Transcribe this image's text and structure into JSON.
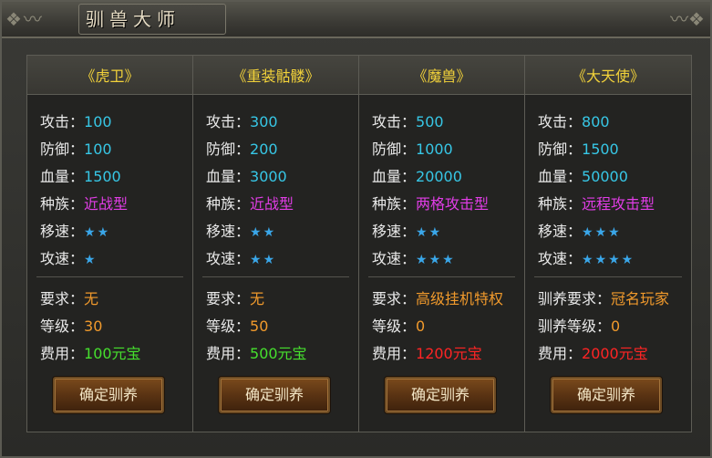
{
  "window": {
    "title": "驯兽大师"
  },
  "cards": [
    {
      "name": "《虎卫》",
      "attack_label": "攻击：",
      "attack": "100",
      "defense_label": "防御：",
      "defense": "100",
      "hp_label": "血量：",
      "hp": "1500",
      "race_label": "种族：",
      "race": "近战型",
      "move_label": "移速：",
      "move_stars": "★★",
      "atkspeed_label": "攻速：",
      "atkspeed_stars": "★",
      "req_label": "要求：",
      "req": "无",
      "level_label": "等级：",
      "level": "30",
      "cost_label": "费用：",
      "cost": "100元宝",
      "button": "确定驯养"
    },
    {
      "name": "《重装骷髅》",
      "attack_label": "攻击：",
      "attack": "300",
      "defense_label": "防御：",
      "defense": "200",
      "hp_label": "血量：",
      "hp": "3000",
      "race_label": "种族：",
      "race": "近战型",
      "move_label": "移速：",
      "move_stars": "★★",
      "atkspeed_label": "攻速：",
      "atkspeed_stars": "★★",
      "req_label": "要求：",
      "req": "无",
      "level_label": "等级：",
      "level": "50",
      "cost_label": "费用：",
      "cost": "500元宝",
      "button": "确定驯养"
    },
    {
      "name": "《魔兽》",
      "attack_label": "攻击：",
      "attack": "500",
      "defense_label": "防御：",
      "defense": "1000",
      "hp_label": "血量：",
      "hp": "20000",
      "race_label": "种族：",
      "race": "两格攻击型",
      "move_label": "移速：",
      "move_stars": "★★",
      "atkspeed_label": "攻速：",
      "atkspeed_stars": "★★★",
      "req_label": "要求：",
      "req": "高级挂机特权",
      "level_label": "等级：",
      "level": "0",
      "cost_label": "费用：",
      "cost": "1200元宝",
      "button": "确定驯养"
    },
    {
      "name": "《大天使》",
      "attack_label": "攻击：",
      "attack": "800",
      "defense_label": "防御：",
      "defense": "1500",
      "hp_label": "血量：",
      "hp": "50000",
      "race_label": "种族：",
      "race": "远程攻击型",
      "move_label": "移速：",
      "move_stars": "★★★",
      "atkspeed_label": "攻速：",
      "atkspeed_stars": "★★★★",
      "req_label": "驯养要求：",
      "req": "冠名玩家",
      "level_label": "驯养等级：",
      "level": "0",
      "cost_label": "费用：",
      "cost": "2000元宝",
      "button": "确定驯养"
    }
  ],
  "colors": {
    "name": "#f2d23a",
    "stat_value": "#37c7e6",
    "race": "#e13de6",
    "stars": "#3aa6e8",
    "requirement": "#f19a2c",
    "cost_green": "#46e02e",
    "cost_red": "#ff2424"
  }
}
